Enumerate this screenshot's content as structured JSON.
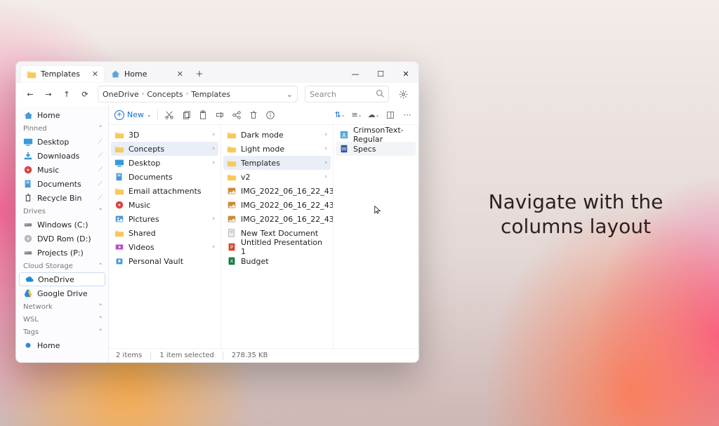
{
  "promo_text": "Navigate with the columns layout",
  "tabs": {
    "active": {
      "label": "Templates"
    },
    "other": {
      "label": "Home"
    }
  },
  "win_controls": {
    "min": "—",
    "max": "☐",
    "close": "✕"
  },
  "nav": {
    "back": "←",
    "forward": "→",
    "up": "↑",
    "refresh": "⟳"
  },
  "breadcrumb": [
    "OneDrive",
    "Concepts",
    "Templates"
  ],
  "search_placeholder": "Search",
  "toolbar": {
    "new_label": "New"
  },
  "sidebar": {
    "home": "Home",
    "groups": [
      {
        "title": "Pinned",
        "items": [
          {
            "label": "Desktop",
            "icon": "desktop",
            "pin": true
          },
          {
            "label": "Downloads",
            "icon": "downloads",
            "pin": true
          },
          {
            "label": "Music",
            "icon": "music",
            "pin": true
          },
          {
            "label": "Documents",
            "icon": "documents",
            "pin": true
          },
          {
            "label": "Recycle Bin",
            "icon": "recycle",
            "pin": true
          }
        ]
      },
      {
        "title": "Drives",
        "items": [
          {
            "label": "Windows (C:)",
            "icon": "drive"
          },
          {
            "label": "DVD Rom (D:)",
            "icon": "dvd"
          },
          {
            "label": "Projects (P:)",
            "icon": "drive"
          }
        ]
      },
      {
        "title": "Cloud Storage",
        "items": [
          {
            "label": "OneDrive",
            "icon": "onedrive",
            "selected": true
          },
          {
            "label": "Google Drive",
            "icon": "gdrive"
          }
        ]
      },
      {
        "title": "Network",
        "items": []
      },
      {
        "title": "WSL",
        "items": []
      },
      {
        "title": "Tags",
        "items": [
          {
            "label": "Home",
            "icon": "tag"
          }
        ]
      }
    ]
  },
  "col1": [
    {
      "label": "3D",
      "icon": "folder",
      "sub": true
    },
    {
      "label": "Concepts",
      "icon": "folder",
      "sub": true,
      "selected": true
    },
    {
      "label": "Desktop",
      "icon": "desktop-doc",
      "sub": true
    },
    {
      "label": "Documents",
      "icon": "documents"
    },
    {
      "label": "Email attachments",
      "icon": "folder"
    },
    {
      "label": "Music",
      "icon": "music-red"
    },
    {
      "label": "Pictures",
      "icon": "pictures",
      "sub": true
    },
    {
      "label": "Shared",
      "icon": "folder"
    },
    {
      "label": "Videos",
      "icon": "videos",
      "sub": true
    },
    {
      "label": "Personal Vault",
      "icon": "vault"
    }
  ],
  "col2": [
    {
      "label": "Dark mode",
      "icon": "folder",
      "sub": true
    },
    {
      "label": "Light mode",
      "icon": "folder",
      "sub": true
    },
    {
      "label": "Templates",
      "icon": "folder",
      "sub": true,
      "selected": true
    },
    {
      "label": "v2",
      "icon": "folder",
      "sub": true
    },
    {
      "label": "IMG_2022_06_16_22_43",
      "icon": "img"
    },
    {
      "label": "IMG_2022_06_16_22_43",
      "icon": "img"
    },
    {
      "label": "IMG_2022_06_16_22_43",
      "icon": "img"
    },
    {
      "label": "New Text Document",
      "icon": "txt"
    },
    {
      "label": "Untitled Presentation 1",
      "icon": "ppt"
    },
    {
      "label": "Budget",
      "icon": "xlsx"
    }
  ],
  "col3": [
    {
      "label": "CrimsonText-Regular",
      "icon": "font"
    },
    {
      "label": "Specs",
      "icon": "doc",
      "highlight": true
    }
  ],
  "status": {
    "count": "2 items",
    "selected": "1 item selected",
    "size": "278.35 KB"
  }
}
